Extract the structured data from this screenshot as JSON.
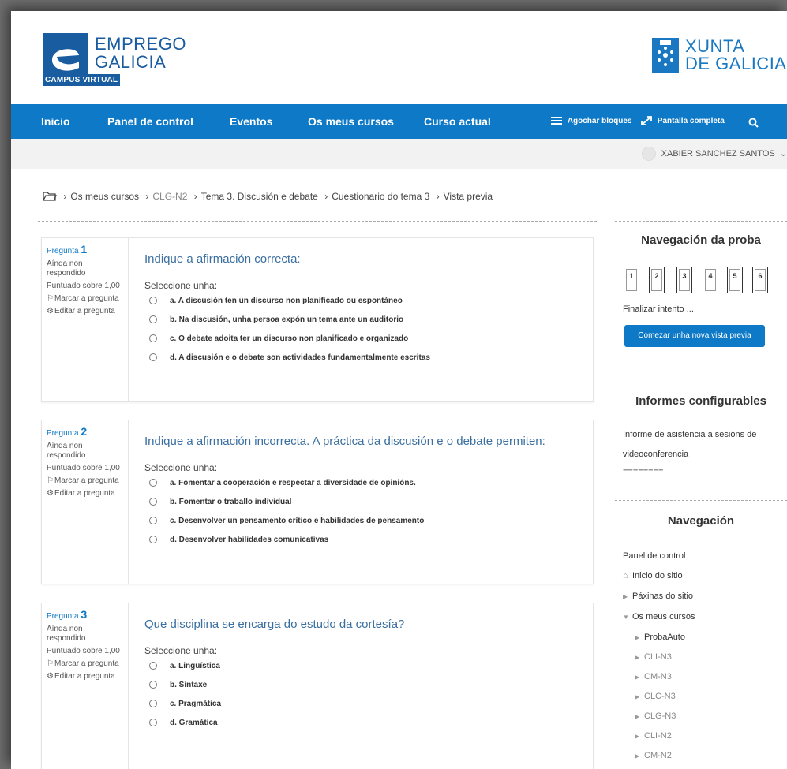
{
  "brand": {
    "left_line1": "EMPREGO",
    "left_line2": "GALICIA",
    "left_tag": "CAMPUS VIRTUAL",
    "right_line1": "XUNTA",
    "right_line2": "DE GALICIA"
  },
  "nav": {
    "items": [
      "Inicio",
      "Panel de control",
      "Eventos",
      "Os meus cursos",
      "Curso actual"
    ],
    "hide_blocks": "Agochar bloques",
    "fullscreen": "Pantalla completa"
  },
  "user": {
    "name": "XABIER SANCHEZ SANTOS"
  },
  "breadcrumb": [
    "Os meus cursos",
    "CLG-N2",
    "Tema 3. Discusión e debate",
    "Cuestionario do tema 3",
    "Vista previa"
  ],
  "questions": [
    {
      "label": "Pregunta",
      "number": "1",
      "state": "Aínda non respondido",
      "points": "Puntuado sobre 1,00",
      "flag": "Marcar a pregunta",
      "edit": "Editar a pregunta",
      "title": "Indique a afirmación correcta:",
      "select": "Seleccione unha:",
      "options": [
        "a. A discusión ten un discurso non planificado ou espontáneo",
        "b. Na discusión, unha persoa expón un tema ante un auditorio",
        "c. O debate adoita ter un discurso non planificado e organizado",
        "d. A discusión e o debate son actividades fundamentalmente escritas"
      ]
    },
    {
      "label": "Pregunta",
      "number": "2",
      "state": "Aínda non respondido",
      "points": "Puntuado sobre 1,00",
      "flag": "Marcar a pregunta",
      "edit": "Editar a pregunta",
      "title": "Indique a afirmación incorrecta. A práctica da discusión e o debate permiten:",
      "select": "Seleccione unha:",
      "options": [
        "a. Fomentar a cooperación e respectar a diversidade de opinións.",
        "b. Fomentar o traballo individual",
        "c. Desenvolver un pensamento crítico e habilidades de pensamento",
        "d. Desenvolver habilidades comunicativas"
      ]
    },
    {
      "label": "Pregunta",
      "number": "3",
      "state": "Aínda non respondido",
      "points": "Puntuado sobre 1,00",
      "flag": "Marcar a pregunta",
      "edit": "Editar a pregunta",
      "title": "Que disciplina se encarga do estudo da cortesía?",
      "select": "Seleccione unha:",
      "options": [
        "a. Lingüística",
        "b. Sintaxe",
        "c. Pragmática",
        "d. Gramática"
      ]
    }
  ],
  "quiz_nav": {
    "title": "Navegación da proba",
    "numbers": [
      "1",
      "2",
      "3",
      "4",
      "5",
      "6"
    ],
    "finish": "Finalizar intento ...",
    "new_preview": "Comezar unha nova vista previa"
  },
  "reports": {
    "title": "Informes configurables",
    "line1": "Informe de asistencia a sesións de",
    "line2": "videoconferencia",
    "line3": "========"
  },
  "navigation": {
    "title": "Navegación",
    "dashboard": "Panel de control",
    "site_home": "Inicio do sitio",
    "site_pages": "Páxinas do sitio",
    "my_courses": "Os meus cursos",
    "courses": [
      "ProbaAuto",
      "CLI-N3",
      "CM-N3",
      "CLC-N3",
      "CLG-N3",
      "CLI-N2",
      "CM-N2"
    ]
  },
  "colors": {
    "primary": "#0e79c6",
    "brand": "#1a5ca0",
    "title_blue": "#3a6fa0"
  }
}
